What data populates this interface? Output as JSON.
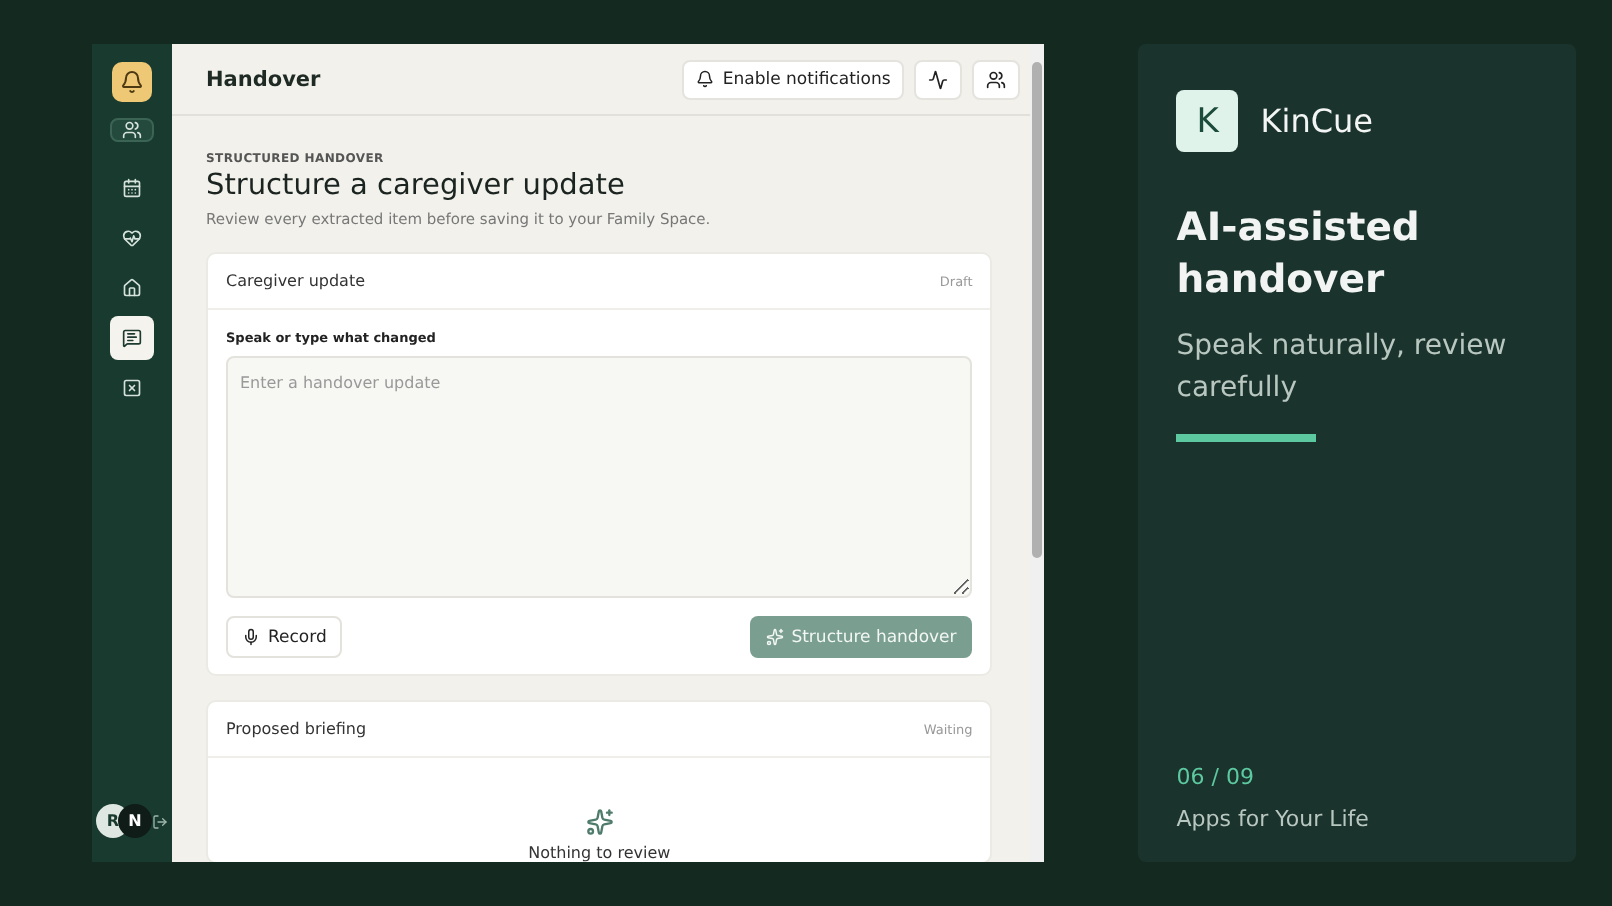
{
  "sidebar": {
    "items": [
      {
        "kind": "users",
        "selected": false,
        "outlined": true
      },
      {
        "kind": "calendar",
        "selected": false,
        "outlined": false
      },
      {
        "kind": "heart",
        "selected": false,
        "outlined": false
      },
      {
        "kind": "home",
        "selected": false,
        "outlined": false
      },
      {
        "kind": "message",
        "selected": true,
        "outlined": false
      },
      {
        "kind": "square-x",
        "selected": false,
        "outlined": false
      }
    ],
    "avatars": [
      "R",
      "N"
    ]
  },
  "header": {
    "title": "Handover",
    "notify_button": "Enable notifications"
  },
  "page": {
    "eyebrow": "STRUCTURED HANDOVER",
    "title": "Structure a caregiver update",
    "subtitle": "Review every extracted item before saving it to your Family Space."
  },
  "update_card": {
    "title": "Caregiver update",
    "status": "Draft",
    "field_label": "Speak or type what changed",
    "placeholder": "Enter a handover update",
    "record_button": "Record",
    "structure_button": "Structure handover",
    "structure_disabled": true
  },
  "briefing_card": {
    "title": "Proposed briefing",
    "status": "Waiting",
    "empty_text": "Nothing to review"
  },
  "promo": {
    "logo_letter": "K",
    "brand": "KinCue",
    "headline": "AI-assisted handover",
    "tagline": "Speak naturally, review carefully",
    "counter": "06 / 09",
    "footer": "Apps for Your Life"
  }
}
